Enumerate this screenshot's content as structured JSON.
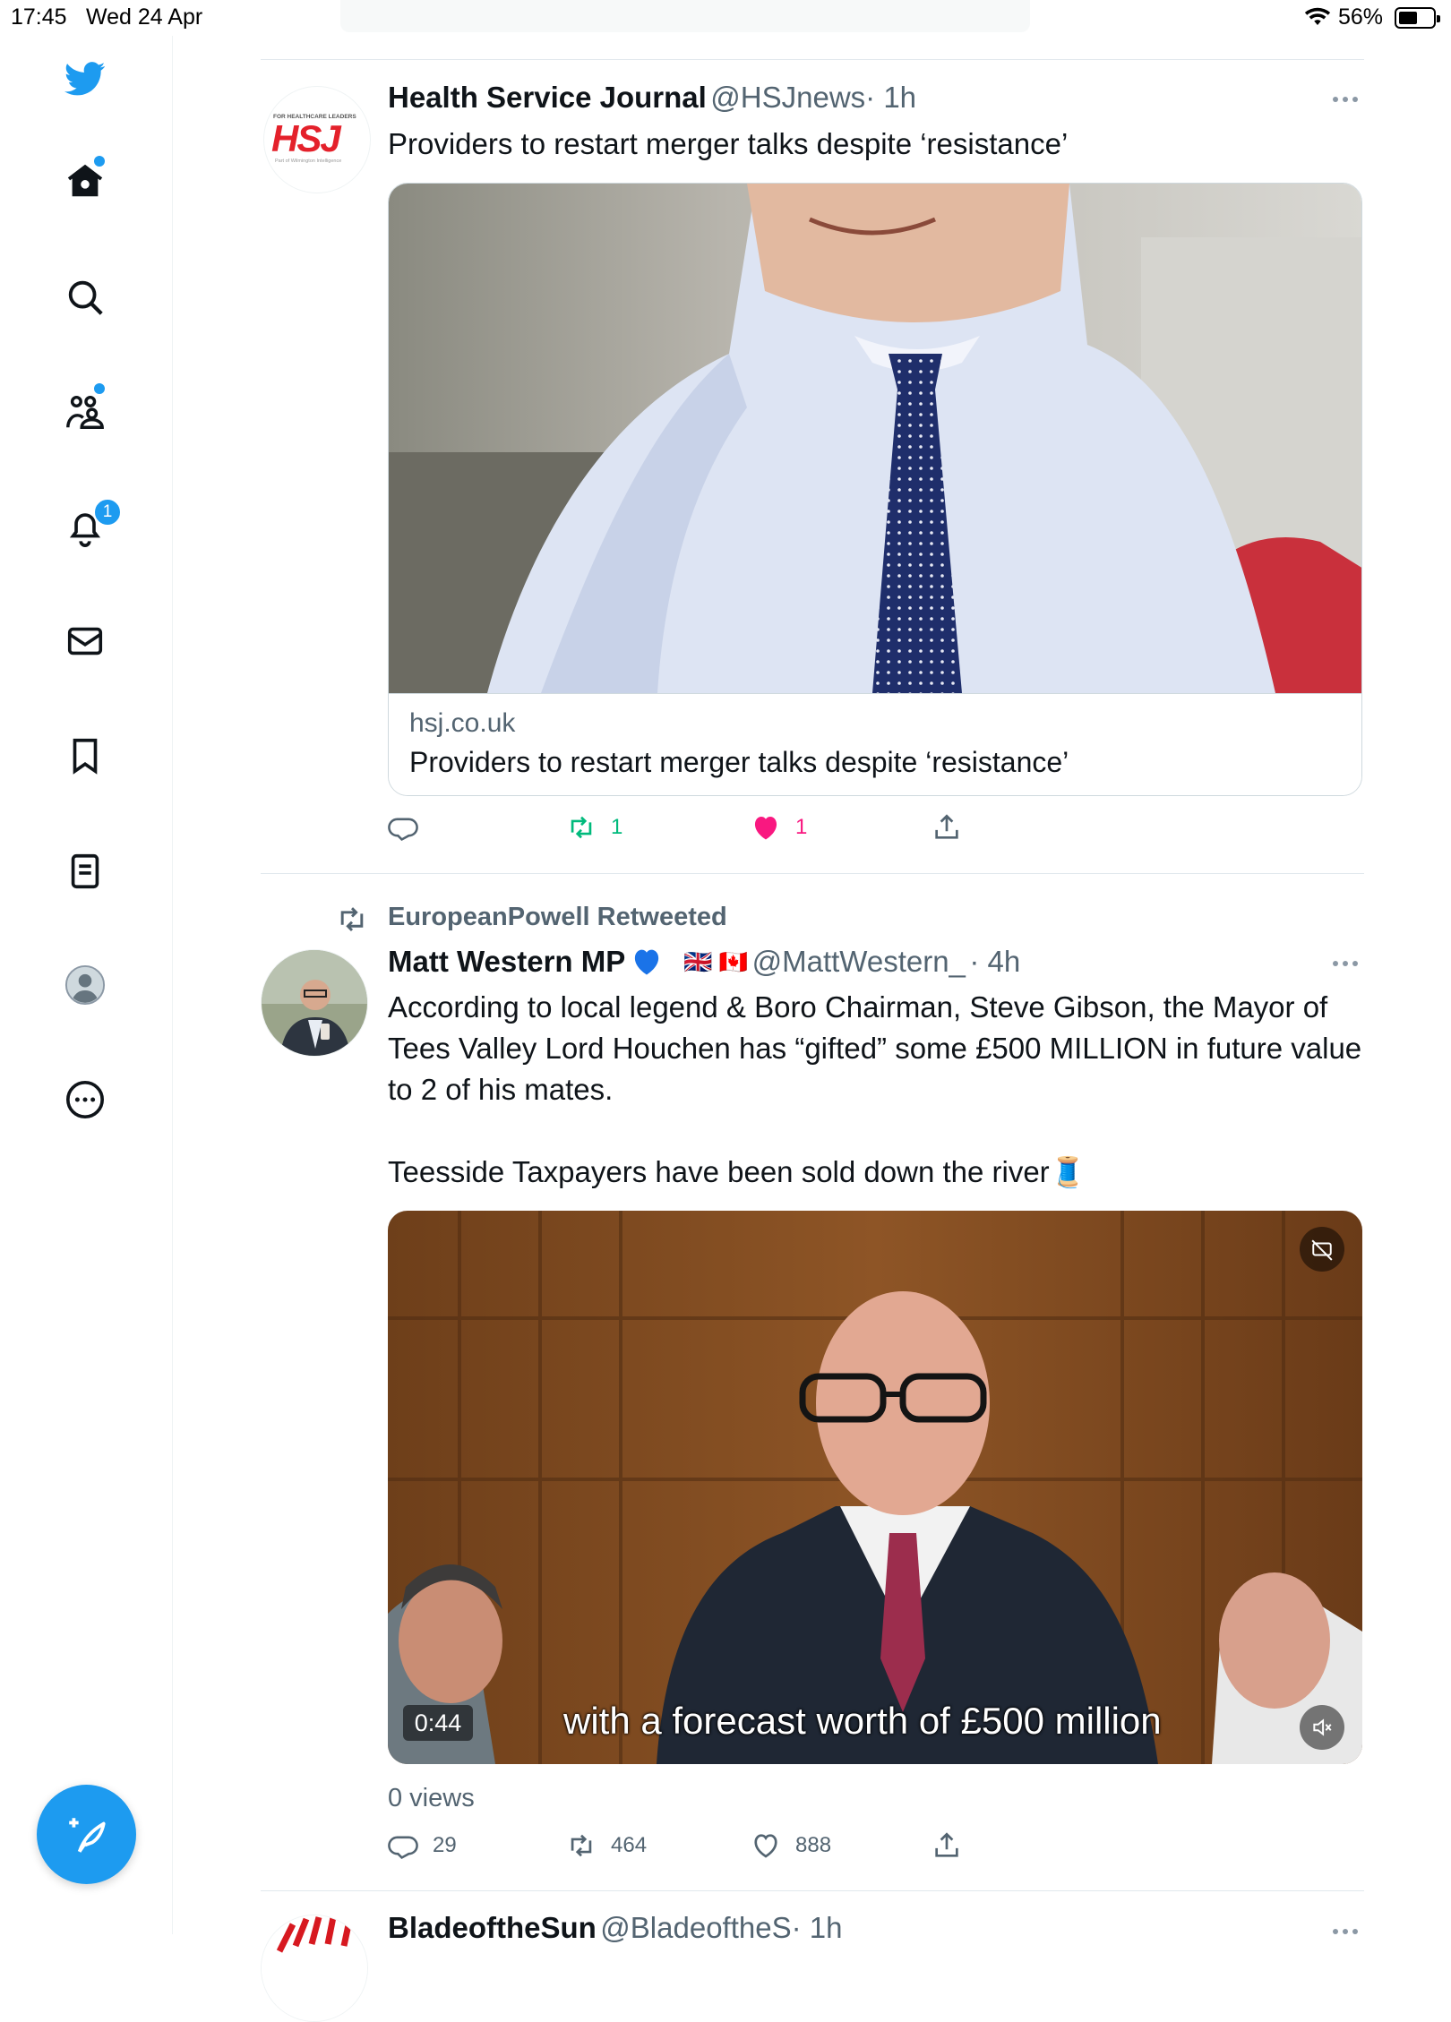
{
  "status_bar": {
    "time": "17:45",
    "date": "Wed 24 Apr",
    "battery": "56%"
  },
  "sidebar": {
    "items": [
      {
        "name": "twitter-logo-icon"
      },
      {
        "name": "home-icon"
      },
      {
        "name": "search-icon"
      },
      {
        "name": "communities-icon"
      },
      {
        "name": "notifications-icon",
        "badge": "1"
      },
      {
        "name": "messages-icon"
      },
      {
        "name": "bookmarks-icon"
      },
      {
        "name": "lists-icon"
      },
      {
        "name": "profile-icon"
      },
      {
        "name": "more-icon"
      }
    ],
    "compose_label": "+"
  },
  "colors": {
    "accent": "#1d9bf0",
    "retweet": "#00ba7c",
    "like": "#f91880",
    "hsj_red": "#e4212b"
  },
  "tweets": [
    {
      "author": "Health Service Journal",
      "handle": "@HSJnews",
      "time": "· 1h",
      "avatar_text": "HSJ",
      "avatar_top": "FOR HEALTHCARE LEADERS",
      "avatar_bottom": "Part of Wilmington Intelligence",
      "text": "Providers to restart merger talks despite ‘resistance’",
      "card": {
        "domain": "hsj.co.uk",
        "title": "Providers to restart merger talks despite ‘resistance’"
      },
      "actions": {
        "replies": "",
        "retweets": "1",
        "likes": "1"
      }
    },
    {
      "retweeted_by": "EuropeanPowell Retweeted",
      "author": "Matt Western MP",
      "handle": "@MattWestern_",
      "time": "· 4h",
      "flags": "🇬🇧 🇨🇦",
      "text_line1": "According to local legend & Boro Chairman, Steve Gibson, the Mayor of Tees Valley Lord Houchen has “gifted” some £500 MILLION in future value to 2 of his mates.",
      "text_line2": "Teesside Taxpayers have been sold down the river🧵",
      "video": {
        "duration": "0:44",
        "caption": "with a forecast worth of £500 million"
      },
      "views": "0 views",
      "actions": {
        "replies": "29",
        "retweets": "464",
        "likes": "888"
      }
    },
    {
      "author": "BladeoftheSun",
      "handle": "@BladeoftheS",
      "time": "· 1h"
    }
  ]
}
